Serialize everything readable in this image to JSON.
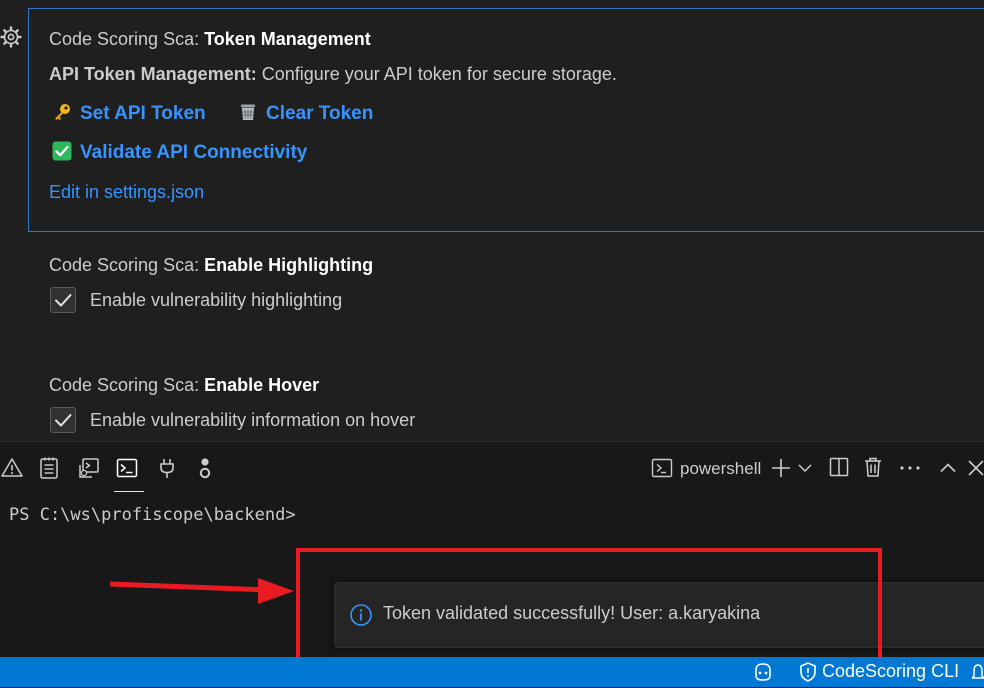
{
  "settings": {
    "token": {
      "prefix": "Code Scoring Sca: ",
      "title": "Token Management",
      "desc_label": "API Token Management:",
      "desc_text": " Configure your API token for secure storage.",
      "set_token": "Set API Token",
      "clear_token": "Clear Token",
      "validate": "Validate API Connectivity",
      "edit_json": "Edit in settings.json"
    },
    "highlighting": {
      "prefix": "Code Scoring Sca: ",
      "title": "Enable Highlighting",
      "checkbox_label": "Enable vulnerability highlighting",
      "checked": true
    },
    "hover": {
      "prefix": "Code Scoring Sca: ",
      "title": "Enable Hover",
      "checkbox_label": "Enable vulnerability information on hover",
      "checked": true
    }
  },
  "panel": {
    "tabs": [
      "problems-icon",
      "output-icon",
      "debug-console-icon",
      "terminal-icon",
      "ports-icon",
      "gitlens-icon"
    ],
    "active_tab": "terminal-icon",
    "terminal_name": "powershell",
    "prompt": "PS C:\\ws\\profiscope\\backend>"
  },
  "notification": {
    "message": "Token validated successfully! User: a.karyakina",
    "icon": "info-icon"
  },
  "statusbar": {
    "cli_label": "CodeScoring CLI"
  },
  "colors": {
    "accent": "#3794ff",
    "focus_border": "#2d78c7",
    "statusbar": "#0078d4",
    "annotation_red": "#e81b22"
  }
}
